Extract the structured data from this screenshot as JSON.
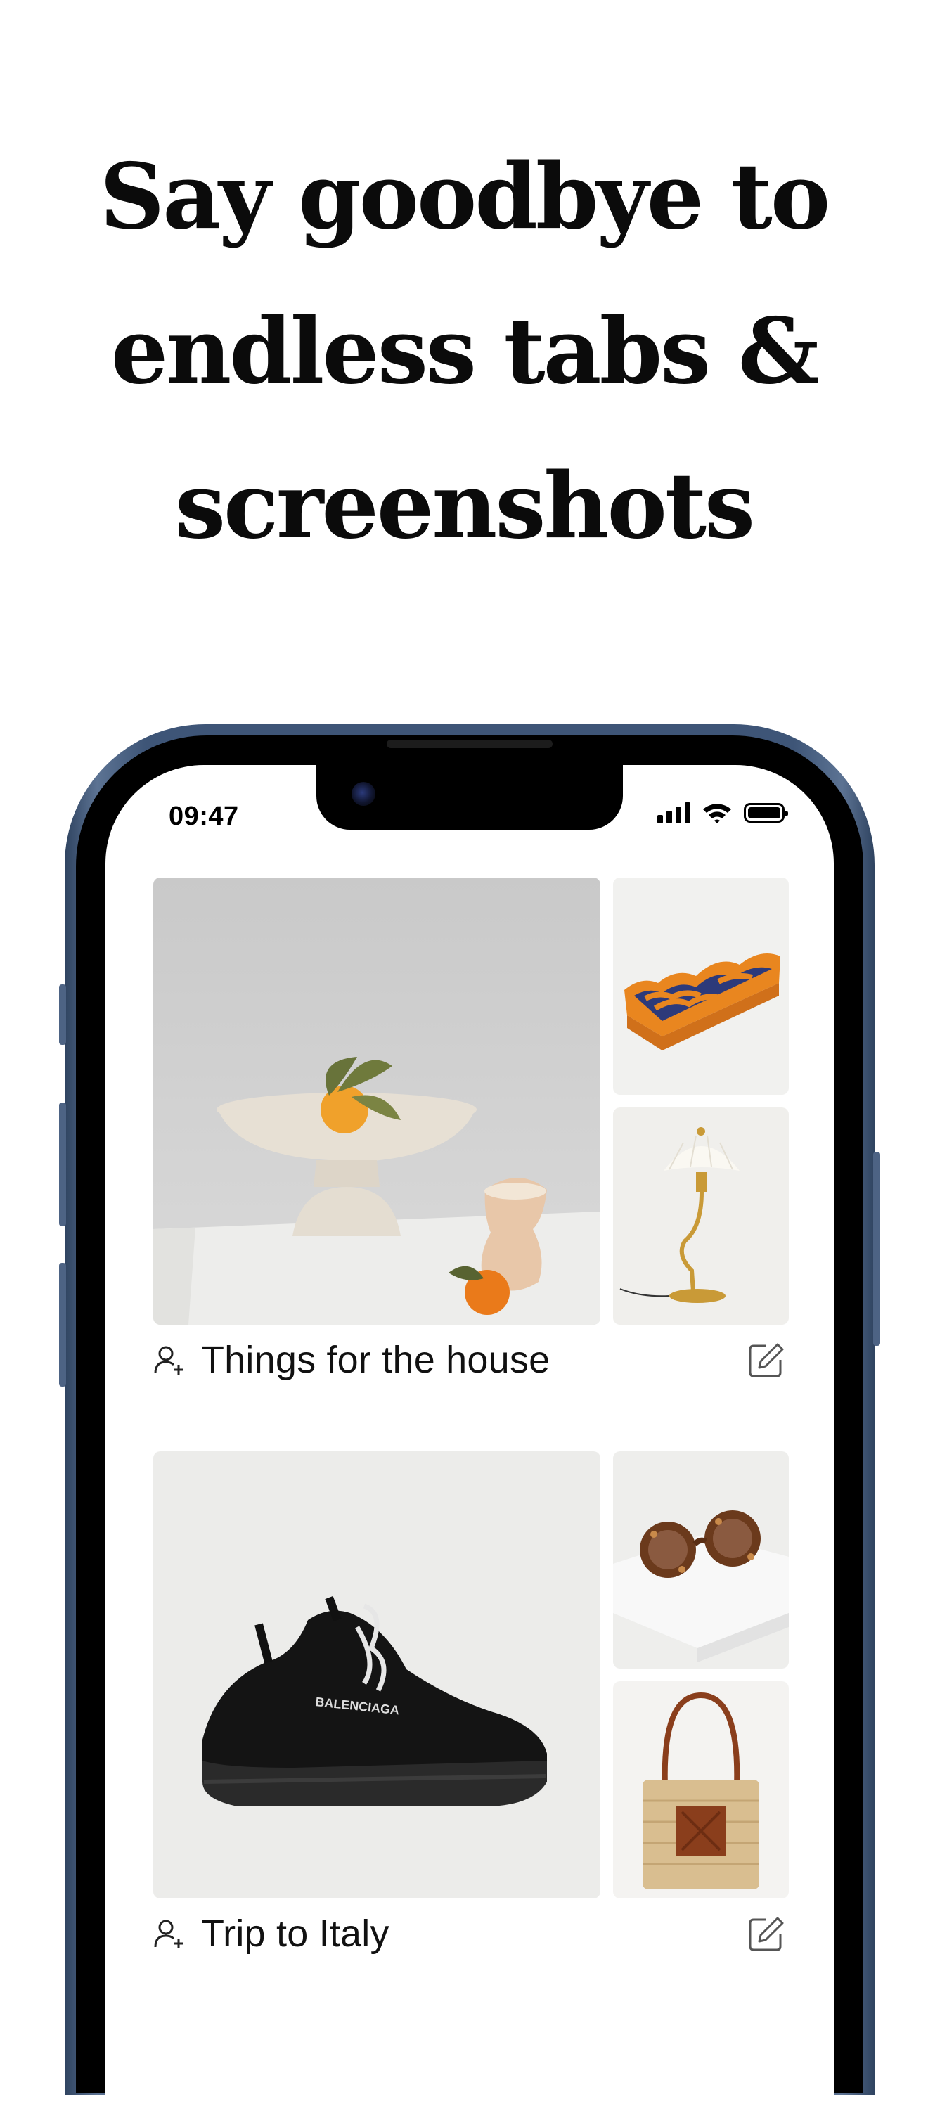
{
  "headline": [
    "Say goodbye to",
    "endless tabs &",
    "screenshots"
  ],
  "status_bar": {
    "time": "09:47",
    "icons": [
      "signal-icon",
      "wifi-icon",
      "battery-icon"
    ]
  },
  "collections": [
    {
      "title": "Things for the house",
      "images": [
        "ceramic-bowl-with-oranges",
        "wavy-orange-tray",
        "pleated-table-lamp"
      ],
      "icons": [
        "add-user-icon",
        "edit-icon"
      ]
    },
    {
      "title": "Trip to Italy",
      "images": [
        "black-balenciaga-sneaker",
        "round-tortoise-sunglasses",
        "straw-tote-bag"
      ],
      "icons": [
        "add-user-icon",
        "edit-icon"
      ]
    }
  ],
  "colors": {
    "frame": "#3e5577",
    "text": "#0b0b0b",
    "accent_orange": "#e07a1f"
  }
}
